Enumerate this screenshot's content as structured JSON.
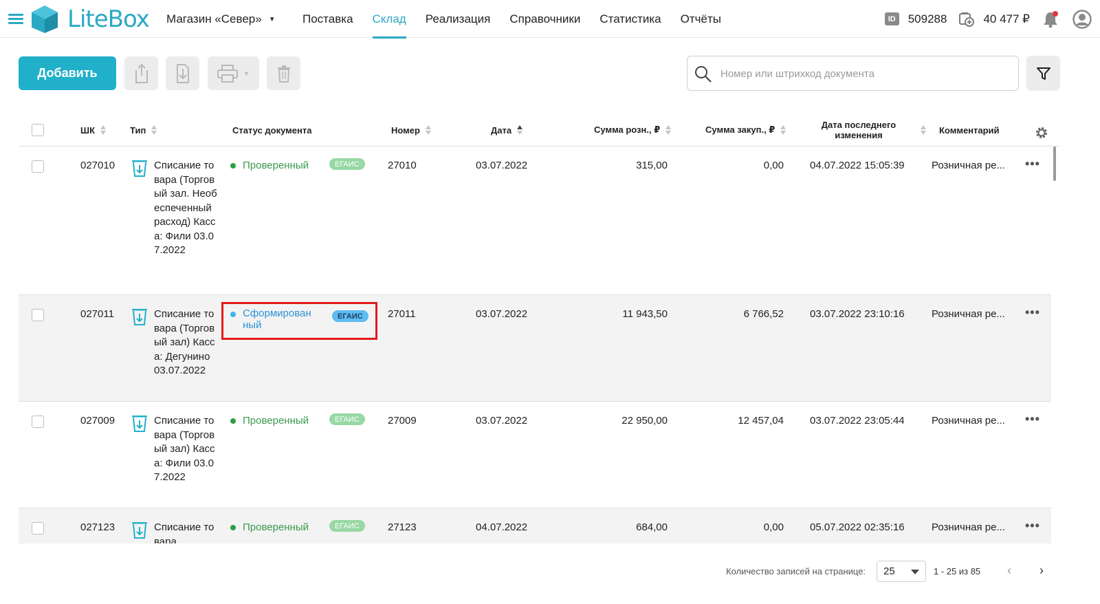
{
  "header": {
    "logo_text": "LiteBox",
    "store": "Магазин «Север»",
    "nav": [
      "Поставка",
      "Склад",
      "Реализация",
      "Справочники",
      "Статистика",
      "Отчёты"
    ],
    "active_nav_index": 1,
    "id_label": "ID",
    "account_id": "509288",
    "balance": "40 477 ₽"
  },
  "toolbar": {
    "add_label": "Добавить",
    "search_placeholder": "Номер или штрихкод документа"
  },
  "columns": {
    "barcode": "ШК",
    "type": "Тип",
    "status": "Статус документа",
    "number": "Номер",
    "date": "Дата",
    "retail_sum": "Сумма розн., ₽",
    "purchase_sum": "Сумма закуп., ₽",
    "last_modified": "Дата последнего изменения",
    "comment": "Комментарий"
  },
  "rows": [
    {
      "barcode": "027010",
      "type": "Списание товара (Торговый зал. Необеспеченный расход) Касса: Фили 03.07.2022",
      "status": "Проверенный",
      "status_color": "#3a9a4d",
      "egais": "ЕГАИС",
      "number": "27010",
      "date": "03.07.2022",
      "retail_sum": "315,00",
      "purchase_sum": "0,00",
      "last_modified": "04.07.2022 15:05:39",
      "comment": "Розничная ре..."
    },
    {
      "barcode": "027011",
      "type": "Списание товара (Торговый зал) Касса: Дегунино 03.07.2022",
      "status": "Сформированный",
      "status_color": "#2b93d6",
      "egais": "ЕГАИС",
      "number": "27011",
      "date": "03.07.2022",
      "retail_sum": "11 943,50",
      "purchase_sum": "6 766,52",
      "last_modified": "03.07.2022 23:10:16",
      "comment": "Розничная ре..."
    },
    {
      "barcode": "027009",
      "type": "Списание товара (Торговый зал) Касса: Фили 03.07.2022",
      "status": "Проверенный",
      "status_color": "#3a9a4d",
      "egais": "ЕГАИС",
      "number": "27009",
      "date": "03.07.2022",
      "retail_sum": "22 950,00",
      "purchase_sum": "12 457,04",
      "last_modified": "03.07.2022 23:05:44",
      "comment": "Розничная ре..."
    },
    {
      "barcode": "027123",
      "type": "Списание товара",
      "status": "Проверенный",
      "status_color": "#3a9a4d",
      "egais": "ЕГАИС",
      "number": "27123",
      "date": "04.07.2022",
      "retail_sum": "684,00",
      "purchase_sum": "0,00",
      "last_modified": "05.07.2022 02:35:16",
      "comment": "Розничная ре..."
    }
  ],
  "footer": {
    "per_page_label": "Количество записей на странице:",
    "per_page_value": "25",
    "range": "1 - 25 из 85"
  },
  "colors": {
    "accent": "#21b0c9",
    "highlight": "#e31a1a",
    "notification": "#e3343f"
  }
}
